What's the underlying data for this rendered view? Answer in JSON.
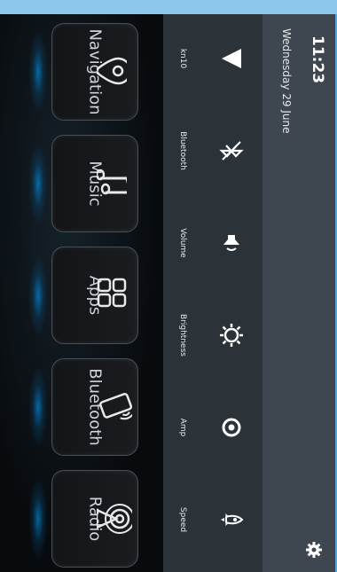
{
  "status": {
    "time": "11:23",
    "date": "Wednesday 29 June"
  },
  "quick_settings": [
    {
      "label": "kn10",
      "icon": "wifi-signal-icon"
    },
    {
      "label": "Bluetooth",
      "icon": "bluetooth-off-icon"
    },
    {
      "label": "Volume",
      "icon": "volume-icon"
    },
    {
      "label": "Brightness",
      "icon": "brightness-icon"
    },
    {
      "label": "Amp",
      "icon": "amp-icon"
    },
    {
      "label": "Speed",
      "icon": "rocket-icon"
    }
  ],
  "apps": [
    {
      "label": "Navigation",
      "icon": "location-pin-icon"
    },
    {
      "label": "Music",
      "icon": "music-note-icon"
    },
    {
      "label": "Apps",
      "icon": "apps-grid-icon"
    },
    {
      "label": "Bluetooth",
      "icon": "phone-bluetooth-icon"
    },
    {
      "label": "Radio",
      "icon": "radio-antenna-icon"
    }
  ],
  "colors": {
    "accent": "#57a4d7",
    "panel": "#2b3339",
    "status": "#3e474f"
  }
}
